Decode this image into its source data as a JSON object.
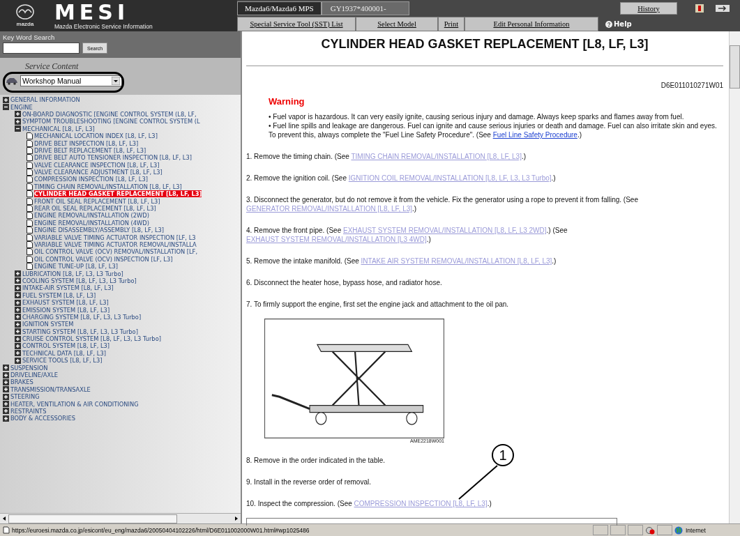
{
  "header": {
    "brand": "mazda",
    "logo": "MESI",
    "subtitle": "Mazda Electronic Service Information",
    "model": "Mazda6/Mazda6 MPS",
    "vin": "GY1937*400001-",
    "history": "History",
    "help": "Help",
    "nav": [
      "Special Service Tool (SST) List",
      "Select Model",
      "Print",
      "Edit Personal Information"
    ]
  },
  "sidebar": {
    "search_label": "Key Word Search",
    "search_button": "Search",
    "content_label": "Service Content",
    "content_select": "Workshop Manual",
    "tree": [
      {
        "label": "GENERAL INFORMATION",
        "kind": "folder",
        "expanded": false,
        "selected": false
      },
      {
        "label": "ENGINE",
        "kind": "folder",
        "expanded": true,
        "selected": false,
        "children": [
          {
            "label": "ON-BOARD DIAGNOSTIC [ENGINE CONTROL SYSTEM (L8, LF,",
            "kind": "folder",
            "expanded": false,
            "selected": false
          },
          {
            "label": "SYMPTOM TROUBLESHOOTING [ENGINE CONTROL SYSTEM (L",
            "kind": "folder",
            "expanded": false,
            "selected": false
          },
          {
            "label": "MECHANICAL [L8, LF, L3]",
            "kind": "folder",
            "expanded": true,
            "selected": false,
            "children": [
              {
                "label": "MECHANICAL LOCATION INDEX [L8, LF, L3]",
                "kind": "page",
                "selected": false
              },
              {
                "label": "DRIVE BELT INSPECTION [L8, LF, L3]",
                "kind": "page",
                "selected": false
              },
              {
                "label": "DRIVE BELT REPLACEMENT [L8, LF, L3]",
                "kind": "page",
                "selected": false
              },
              {
                "label": "DRIVE BELT AUTO TENSIONER INSPECTION [L8, LF, L3]",
                "kind": "page",
                "selected": false
              },
              {
                "label": "VALVE CLEARANCE INSPECTION [L8, LF, L3]",
                "kind": "page",
                "selected": false
              },
              {
                "label": "VALVE CLEARANCE ADJUSTMENT [L8, LF, L3]",
                "kind": "page",
                "selected": false
              },
              {
                "label": "COMPRESSION INSPECTION [L8, LF, L3]",
                "kind": "page",
                "selected": false
              },
              {
                "label": "TIMING CHAIN REMOVAL/INSTALLATION [L8, LF, L3]",
                "kind": "page",
                "selected": false
              },
              {
                "label": "CYLINDER HEAD GASKET REPLACEMENT [L8, LF, L3]",
                "kind": "page",
                "selected": true
              },
              {
                "label": "FRONT OIL SEAL REPLACEMENT [L8, LF, L3]",
                "kind": "page",
                "selected": false
              },
              {
                "label": "REAR OIL SEAL REPLACEMENT [L8, LF, L3]",
                "kind": "page",
                "selected": false
              },
              {
                "label": "ENGINE REMOVAL/INSTALLATION (2WD)",
                "kind": "page",
                "selected": false
              },
              {
                "label": "ENGINE REMOVAL/INSTALLATION (4WD)",
                "kind": "page",
                "selected": false
              },
              {
                "label": "ENGINE DISASSEMBLY/ASSEMBLY [L8, LF, L3]",
                "kind": "page",
                "selected": false
              },
              {
                "label": "VARIABLE VALVE TIMING ACTUATOR INSPECTION [LF, L3",
                "kind": "page",
                "selected": false
              },
              {
                "label": "VARIABLE VALVE TIMING ACTUATOR REMOVAL/INSTALLA",
                "kind": "page",
                "selected": false
              },
              {
                "label": "OIL CONTROL VALVE (OCV) REMOVAL/INSTALLATION [LF,",
                "kind": "page",
                "selected": false
              },
              {
                "label": "OIL CONTROL VALVE (OCV) INSPECTION [LF, L3]",
                "kind": "page",
                "selected": false
              },
              {
                "label": "ENGINE TUNE-UP [L8, LF, L3]",
                "kind": "page",
                "selected": false
              }
            ]
          },
          {
            "label": "LUBRICATION [L8, LF, L3, L3 Turbo]",
            "kind": "folder",
            "expanded": false,
            "selected": false
          },
          {
            "label": "COOLING SYSTEM [L8, LF, L3, L3 Turbo]",
            "kind": "folder",
            "expanded": false,
            "selected": false
          },
          {
            "label": "INTAKE-AIR SYSTEM [L8, LF, L3]",
            "kind": "folder",
            "expanded": false,
            "selected": false
          },
          {
            "label": "FUEL SYSTEM [L8, LF, L3]",
            "kind": "folder",
            "expanded": false,
            "selected": false
          },
          {
            "label": "EXHAUST SYSTEM [L8, LF, L3]",
            "kind": "folder",
            "expanded": false,
            "selected": false
          },
          {
            "label": "EMISSION SYSTEM [L8, LF, L3]",
            "kind": "folder",
            "expanded": false,
            "selected": false
          },
          {
            "label": "CHARGING SYSTEM [L8, LF, L3, L3 Turbo]",
            "kind": "folder",
            "expanded": false,
            "selected": false
          },
          {
            "label": "IGNITION SYSTEM",
            "kind": "folder",
            "expanded": false,
            "selected": false
          },
          {
            "label": "STARTING SYSTEM [L8, LF, L3, L3 Turbo]",
            "kind": "folder",
            "expanded": false,
            "selected": false
          },
          {
            "label": "CRUISE CONTROL SYSTEM [L8, LF, L3, L3 Turbo]",
            "kind": "folder",
            "expanded": false,
            "selected": false
          },
          {
            "label": "CONTROL SYSTEM [L8, LF, L3]",
            "kind": "folder",
            "expanded": false,
            "selected": false
          },
          {
            "label": "TECHNICAL DATA [L8, LF, L3]",
            "kind": "folder",
            "expanded": false,
            "selected": false
          },
          {
            "label": "SERVICE TOOLS [L8, LF, L3]",
            "kind": "folder",
            "expanded": false,
            "selected": false
          }
        ]
      },
      {
        "label": "SUSPENSION",
        "kind": "folder",
        "expanded": false,
        "selected": false
      },
      {
        "label": "DRIVELINE/AXLE",
        "kind": "folder",
        "expanded": false,
        "selected": false
      },
      {
        "label": "BRAKES",
        "kind": "folder",
        "expanded": false,
        "selected": false
      },
      {
        "label": "TRANSMISSION/TRANSAXLE",
        "kind": "folder",
        "expanded": false,
        "selected": false
      },
      {
        "label": "STEERING",
        "kind": "folder",
        "expanded": false,
        "selected": false
      },
      {
        "label": "HEATER, VENTILATION & AIR CONDITIONING",
        "kind": "folder",
        "expanded": false,
        "selected": false
      },
      {
        "label": "RESTRAINTS",
        "kind": "folder",
        "expanded": false,
        "selected": false
      },
      {
        "label": "BODY & ACCESSORIES",
        "kind": "folder",
        "expanded": false,
        "selected": false
      }
    ]
  },
  "document": {
    "title": "CYLINDER HEAD GASKET REPLACEMENT [L8, LF, L3]",
    "doc_id": "D6E011010271W01",
    "warning_heading": "Warning",
    "warnings": [
      [
        {
          "kind": "text",
          "text": "• Fuel vapor is hazardous. It can very easily ignite, causing serious injury and damage. Always keep sparks and flames away from fuel."
        }
      ],
      [
        {
          "kind": "text",
          "text": "• Fuel line spills and leakage are dangerous. Fuel can ignite and cause serious injuries or death and damage. Fuel can also irritate skin and eyes. To prevent this, always complete the \"Fuel Line Safety Procedure\". (See "
        },
        {
          "kind": "link",
          "text": "Fuel Line Safety Procedure",
          "visited": false
        },
        {
          "kind": "text",
          "text": ".)"
        }
      ]
    ],
    "steps": [
      [
        {
          "kind": "text",
          "text": "1. Remove the timing chain. (See "
        },
        {
          "kind": "link",
          "text": "TIMING CHAIN REMOVAL/INSTALLATION [L8, LF, L3]",
          "visited": true
        },
        {
          "kind": "text",
          "text": ".)"
        }
      ],
      [
        {
          "kind": "text",
          "text": "2. Remove the ignition coil. (See "
        },
        {
          "kind": "link",
          "text": "IGNITION COIL REMOVAL/INSTALLATION [L8, LF, L3, L3 Turbo]",
          "visited": true
        },
        {
          "kind": "text",
          "text": ".)"
        }
      ],
      [
        {
          "kind": "text",
          "text": "3. Disconnect the generator, but do not remove it from the vehicle. Fix the generator using a rope to prevent it from falling. (See "
        },
        {
          "kind": "link",
          "text": "GENERATOR REMOVAL/INSTALLATION [L8, LF, L3]",
          "visited": true
        },
        {
          "kind": "text",
          "text": ".)"
        }
      ],
      [
        {
          "kind": "text",
          "text": "4. Remove the front pipe. (See "
        },
        {
          "kind": "link",
          "text": "EXHAUST SYSTEM REMOVAL/INSTALLATION [L8, LF, L3 2WD]",
          "visited": true
        },
        {
          "kind": "text",
          "text": ".) (See "
        },
        {
          "kind": "link",
          "text": "EXHAUST SYSTEM REMOVAL/INSTALLATION [L3 4WD]",
          "visited": true
        },
        {
          "kind": "text",
          "text": ".)"
        }
      ],
      [
        {
          "kind": "text",
          "text": "5. Remove the intake manifold. (See "
        },
        {
          "kind": "link",
          "text": "INTAKE AIR SYSTEM REMOVAL/INSTALLATION [L8, LF, L3]",
          "visited": true
        },
        {
          "kind": "text",
          "text": ".)"
        }
      ],
      [
        {
          "kind": "text",
          "text": "6. Disconnect the heater hose, bypass hose, and radiator hose."
        }
      ],
      [
        {
          "kind": "text",
          "text": "7. To firmly support the engine, first set the engine jack and attachment to the oil pan."
        }
      ]
    ],
    "figure_caption": "AME2218W001",
    "steps_after": [
      [
        {
          "kind": "text",
          "text": "8. Remove in the order indicated in the table."
        }
      ],
      [
        {
          "kind": "text",
          "text": "9. Install in the reverse order of removal."
        }
      ],
      [
        {
          "kind": "text",
          "text": "10. Inspect the compression. (See "
        },
        {
          "kind": "link",
          "text": "COMPRESSION INSPECTION [L8, LF, L3]",
          "visited": true
        },
        {
          "kind": "text",
          "text": ".)"
        }
      ]
    ],
    "callout": "1"
  },
  "status_bar": {
    "url": "https://euroesi.mazda.co.jp/esicont/eu_eng/mazda6/20050404102226/html/D6E011002000W01.html#wp1025486",
    "zone": "Internet"
  }
}
